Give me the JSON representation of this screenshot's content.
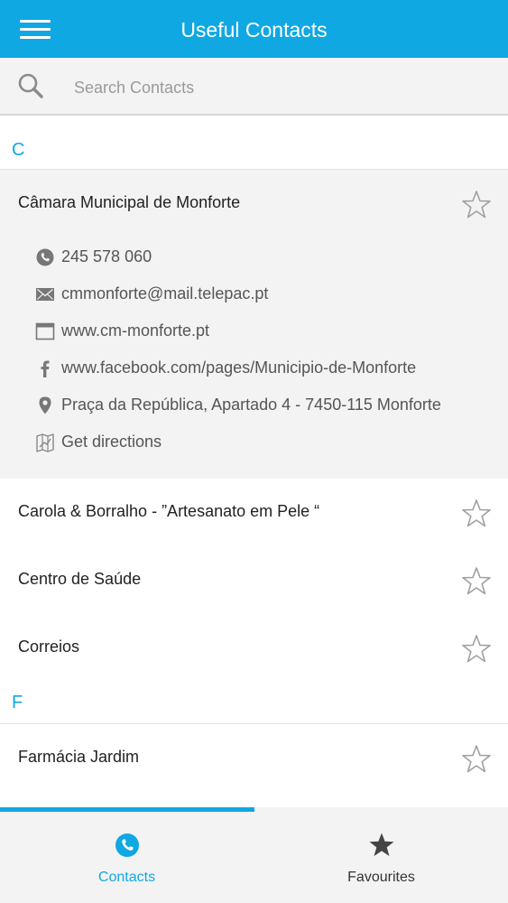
{
  "header": {
    "title": "Useful Contacts",
    "menu_icon": "menu-icon"
  },
  "search": {
    "placeholder": "Search Contacts",
    "value": ""
  },
  "sections": [
    {
      "letter": "C"
    },
    {
      "letter": "F"
    }
  ],
  "contacts": [
    {
      "name": "Câmara Municipal de Monforte",
      "expanded": true
    },
    {
      "name": "Carola & Borralho - ”Artesanato em Pele “"
    },
    {
      "name": "Centro de Saúde"
    },
    {
      "name": "Correios"
    },
    {
      "name": "Farmácia Jardim"
    }
  ],
  "details": [
    {
      "icon": "phone-icon",
      "text": "245 578 060"
    },
    {
      "icon": "email-icon",
      "text": "cmmonforte@mail.telepac.pt"
    },
    {
      "icon": "web-icon",
      "text": "www.cm-monforte.pt"
    },
    {
      "icon": "facebook-icon",
      "text": "www.facebook.com/pages/Municipio-de-Monforte"
    },
    {
      "icon": "location-pin-icon",
      "text": "Praça da República, Apartado 4 - 7450-115 Monforte"
    },
    {
      "icon": "directions-map-icon",
      "text": "Get directions"
    }
  ],
  "tabs": [
    {
      "label": "Contacts",
      "icon": "phone-icon",
      "active": true
    },
    {
      "label": "Favourites",
      "icon": "star-icon",
      "active": false
    }
  ],
  "colors": {
    "accent": "#0fa8e3",
    "detail_background": "#f3f3f3",
    "tab_inactive": "#333333"
  }
}
